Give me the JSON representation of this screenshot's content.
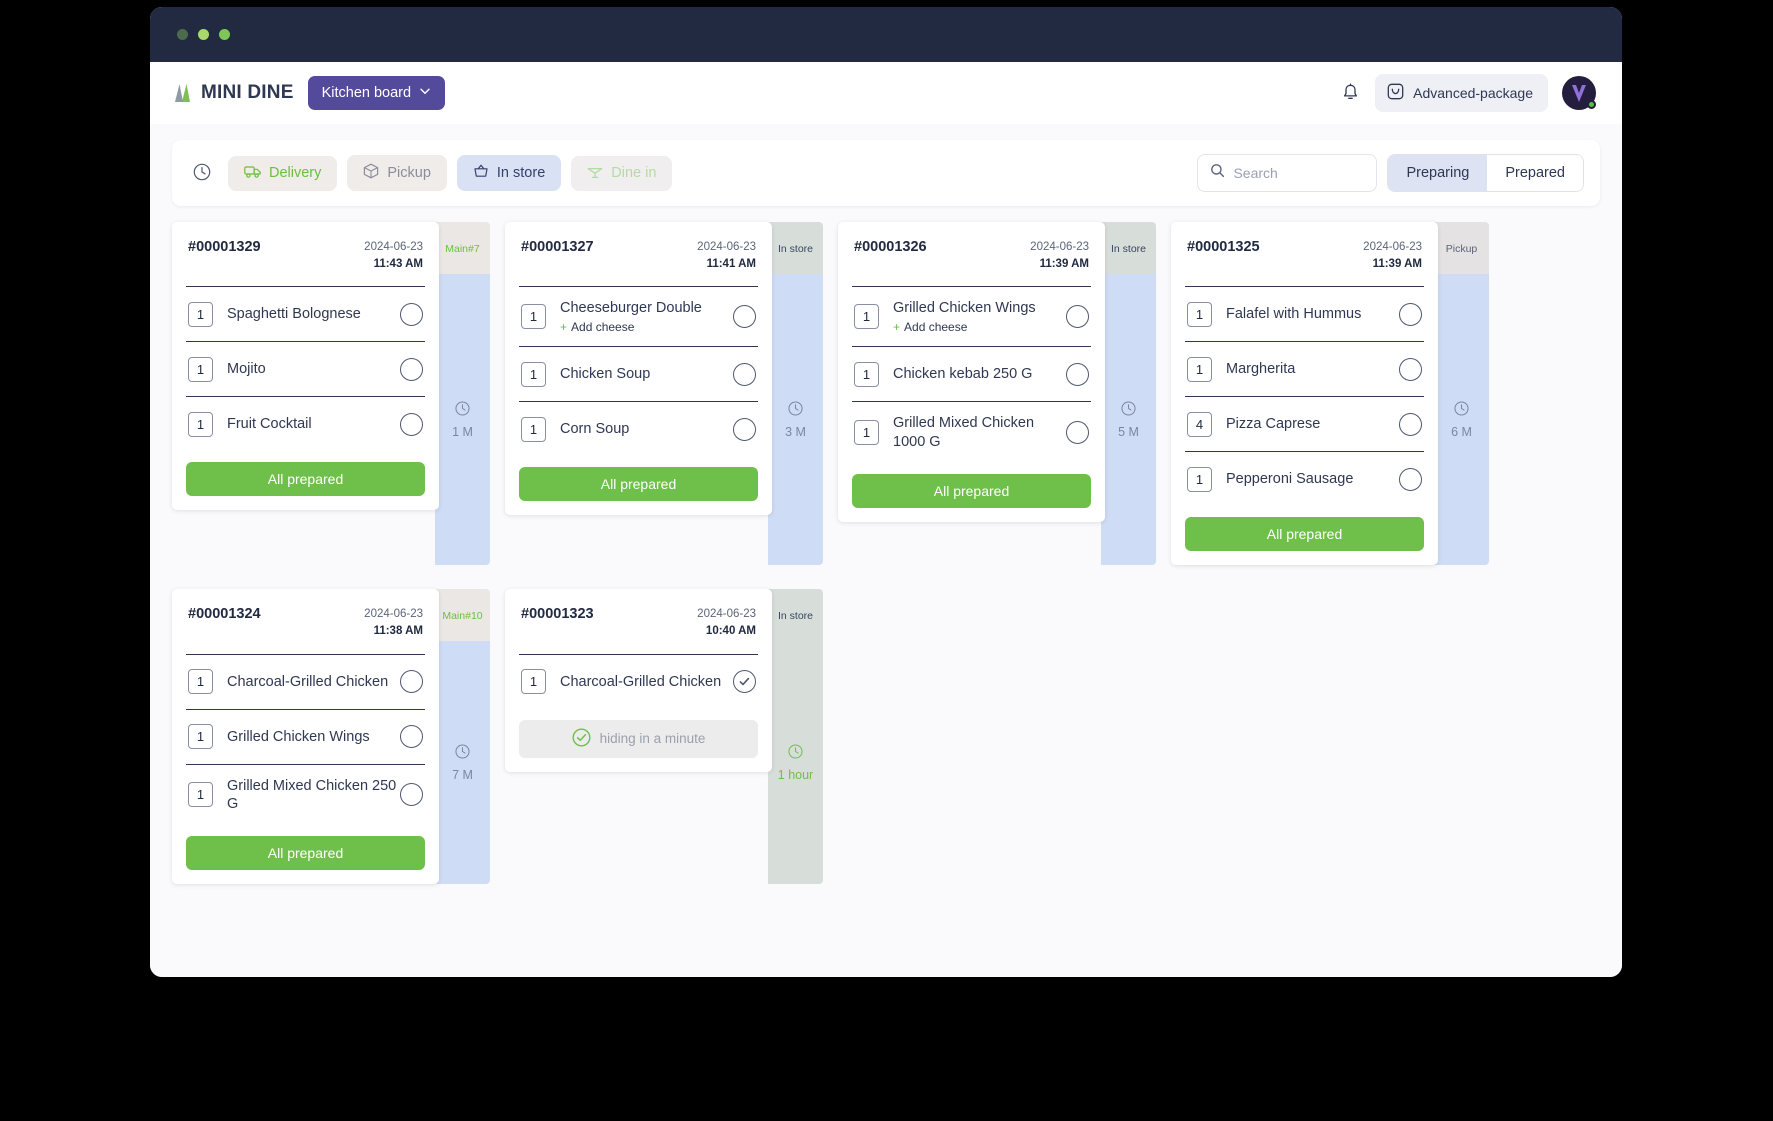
{
  "window": {
    "dots": [
      "#4c6b4b",
      "#a8d86a",
      "#7ec756"
    ]
  },
  "header": {
    "brand_name": "MINI DINE",
    "board_label": "Kitchen board",
    "package_label": "Advanced-package",
    "bell_icon": "bell-icon",
    "package_icon": "package-icon",
    "chevron_icon": "chevron-down-icon"
  },
  "toolbar": {
    "clock_icon": "clock-icon",
    "chips": [
      {
        "label": "Delivery",
        "icon": "delivery-truck-icon",
        "state": "delivery"
      },
      {
        "label": "Pickup",
        "icon": "package-box-icon",
        "state": "pickup"
      },
      {
        "label": "In store",
        "icon": "basket-icon",
        "state": "instore"
      },
      {
        "label": "Dine in",
        "icon": "dine-in-icon",
        "state": "dinein"
      }
    ],
    "search": {
      "placeholder": "Search",
      "value": "",
      "icon": "search-icon"
    },
    "segments": [
      {
        "label": "Preparing",
        "active": true
      },
      {
        "label": "Prepared",
        "active": false
      }
    ]
  },
  "colors": {
    "accent_green": "#6fc04a",
    "brand_purple": "#534a9c",
    "dark_navy": "#212a41",
    "rail_blue": "#cfdcf5"
  },
  "orders": [
    {
      "id": "#00001329",
      "date": "2024-06-23",
      "time": "11:43 AM",
      "rail_type": "main",
      "rail_label": "Main",
      "rail_label2": "#7",
      "elapsed": "1 M",
      "action_label": "All prepared",
      "items": [
        {
          "qty": "1",
          "name": "Spaghetti Bolognese",
          "addon": "",
          "done": false
        },
        {
          "qty": "1",
          "name": "Mojito",
          "addon": "",
          "done": false
        },
        {
          "qty": "1",
          "name": "Fruit Cocktail",
          "addon": "",
          "done": false
        }
      ]
    },
    {
      "id": "#00001327",
      "date": "2024-06-23",
      "time": "11:41 AM",
      "rail_type": "store",
      "rail_label": "In store",
      "rail_label2": "",
      "elapsed": "3 M",
      "action_label": "All prepared",
      "items": [
        {
          "qty": "1",
          "name": "Cheeseburger Double",
          "addon": "Add cheese",
          "done": false
        },
        {
          "qty": "1",
          "name": "Chicken Soup",
          "addon": "",
          "done": false
        },
        {
          "qty": "1",
          "name": "Corn Soup",
          "addon": "",
          "done": false
        }
      ]
    },
    {
      "id": "#00001326",
      "date": "2024-06-23",
      "time": "11:39 AM",
      "rail_type": "store",
      "rail_label": "In store",
      "rail_label2": "",
      "elapsed": "5 M",
      "action_label": "All prepared",
      "items": [
        {
          "qty": "1",
          "name": "Grilled Chicken Wings",
          "addon": "Add cheese",
          "done": false
        },
        {
          "qty": "1",
          "name": "Chicken kebab 250 G",
          "addon": "",
          "done": false
        },
        {
          "qty": "1",
          "name": "Grilled Mixed Chicken 1000 G",
          "addon": "",
          "done": false
        }
      ]
    },
    {
      "id": "#00001325",
      "date": "2024-06-23",
      "time": "11:39 AM",
      "rail_type": "pickup",
      "rail_label": "Pickup",
      "rail_label2": "",
      "elapsed": "6 M",
      "action_label": "All prepared",
      "items": [
        {
          "qty": "1",
          "name": "Falafel with Hummus",
          "addon": "",
          "done": false
        },
        {
          "qty": "1",
          "name": "Margherita",
          "addon": "",
          "done": false
        },
        {
          "qty": "4",
          "name": "Pizza Caprese",
          "addon": "",
          "done": false
        },
        {
          "qty": "1",
          "name": "Pepperoni Sausage",
          "addon": "",
          "done": false
        }
      ]
    },
    {
      "id": "#00001324",
      "date": "2024-06-23",
      "time": "11:38 AM",
      "rail_type": "main",
      "rail_label": "Main",
      "rail_label2": "#10",
      "elapsed": "7 M",
      "action_label": "All prepared",
      "items": [
        {
          "qty": "1",
          "name": "Charcoal-Grilled Chicken",
          "addon": "",
          "done": false
        },
        {
          "qty": "1",
          "name": "Grilled Chicken Wings",
          "addon": "",
          "done": false
        },
        {
          "qty": "1",
          "name": "Grilled Mixed Chicken 250 G",
          "addon": "",
          "done": false
        }
      ]
    },
    {
      "id": "#00001323",
      "date": "2024-06-23",
      "time": "10:40 AM",
      "rail_type": "store",
      "rail_label": "In store",
      "rail_label2": "",
      "elapsed": "1 hour",
      "completed": true,
      "hiding_label": "hiding in a minute",
      "items": [
        {
          "qty": "1",
          "name": "Charcoal-Grilled Chicken",
          "addon": "",
          "done": true
        }
      ]
    }
  ]
}
